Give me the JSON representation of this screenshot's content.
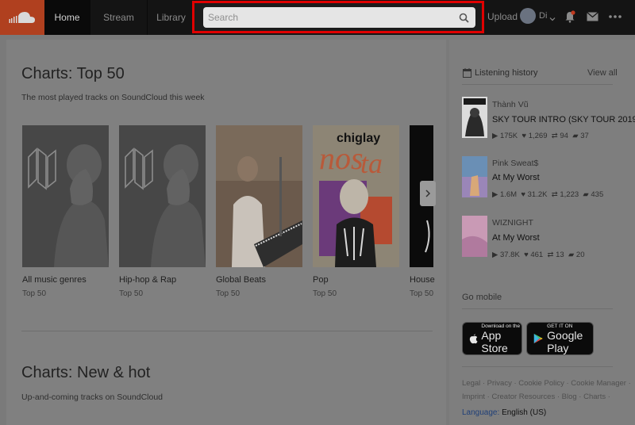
{
  "header": {
    "logo_icon": "soundcloud-logo-icon",
    "nav": [
      {
        "label": "Home",
        "active": true
      },
      {
        "label": "Stream",
        "active": false
      },
      {
        "label": "Library",
        "active": false
      }
    ],
    "search": {
      "placeholder": "Search",
      "value": ""
    },
    "upload_label": "Upload",
    "user_name": "Di",
    "icons": [
      "notifications-icon",
      "messages-icon",
      "more-icon"
    ],
    "highlight_color": "#e00000"
  },
  "charts_top50": {
    "title": "Charts: Top 50",
    "subtitle": "The most played tracks on SoundCloud this week",
    "cards": [
      {
        "title": "All music genres",
        "sub": "Top 50"
      },
      {
        "title": "Hip-hop & Rap",
        "sub": "Top 50"
      },
      {
        "title": "Global Beats",
        "sub": "Top 50"
      },
      {
        "title": "Pop",
        "sub": "Top 50"
      },
      {
        "title": "House",
        "sub": "Top 50"
      }
    ],
    "pop_cover_text": "chiglay"
  },
  "charts_new": {
    "title": "Charts: New & hot",
    "subtitle": "Up-and-coming tracks on SoundCloud"
  },
  "sidebar": {
    "history_title": "Listening history",
    "view_all": "View all",
    "history": [
      {
        "artist": "Thành Vũ",
        "track": "SKY TOUR INTRO (SKY TOUR 2019...",
        "plays": "175K",
        "likes": "1,269",
        "reposts": "94",
        "comments": "37"
      },
      {
        "artist": "Pink Sweat$",
        "track": "At My Worst",
        "plays": "1.6M",
        "likes": "31.2K",
        "reposts": "1,223",
        "comments": "435"
      },
      {
        "artist": "WIZNIGHT",
        "track": "At My Worst",
        "plays": "37.8K",
        "likes": "461",
        "reposts": "13",
        "comments": "20"
      }
    ],
    "go_mobile": "Go mobile",
    "app_store": {
      "small": "Download on the",
      "big": "App Store"
    },
    "google_play": {
      "small": "GET IT ON",
      "big": "Google Play"
    },
    "footer_line1": "Legal · Privacy · Cookie Policy · Cookie Manager ·",
    "footer_line2": "Imprint · Creator Resources · Blog · Charts ·",
    "language_label": "Language:",
    "language_value": "English (US)"
  }
}
